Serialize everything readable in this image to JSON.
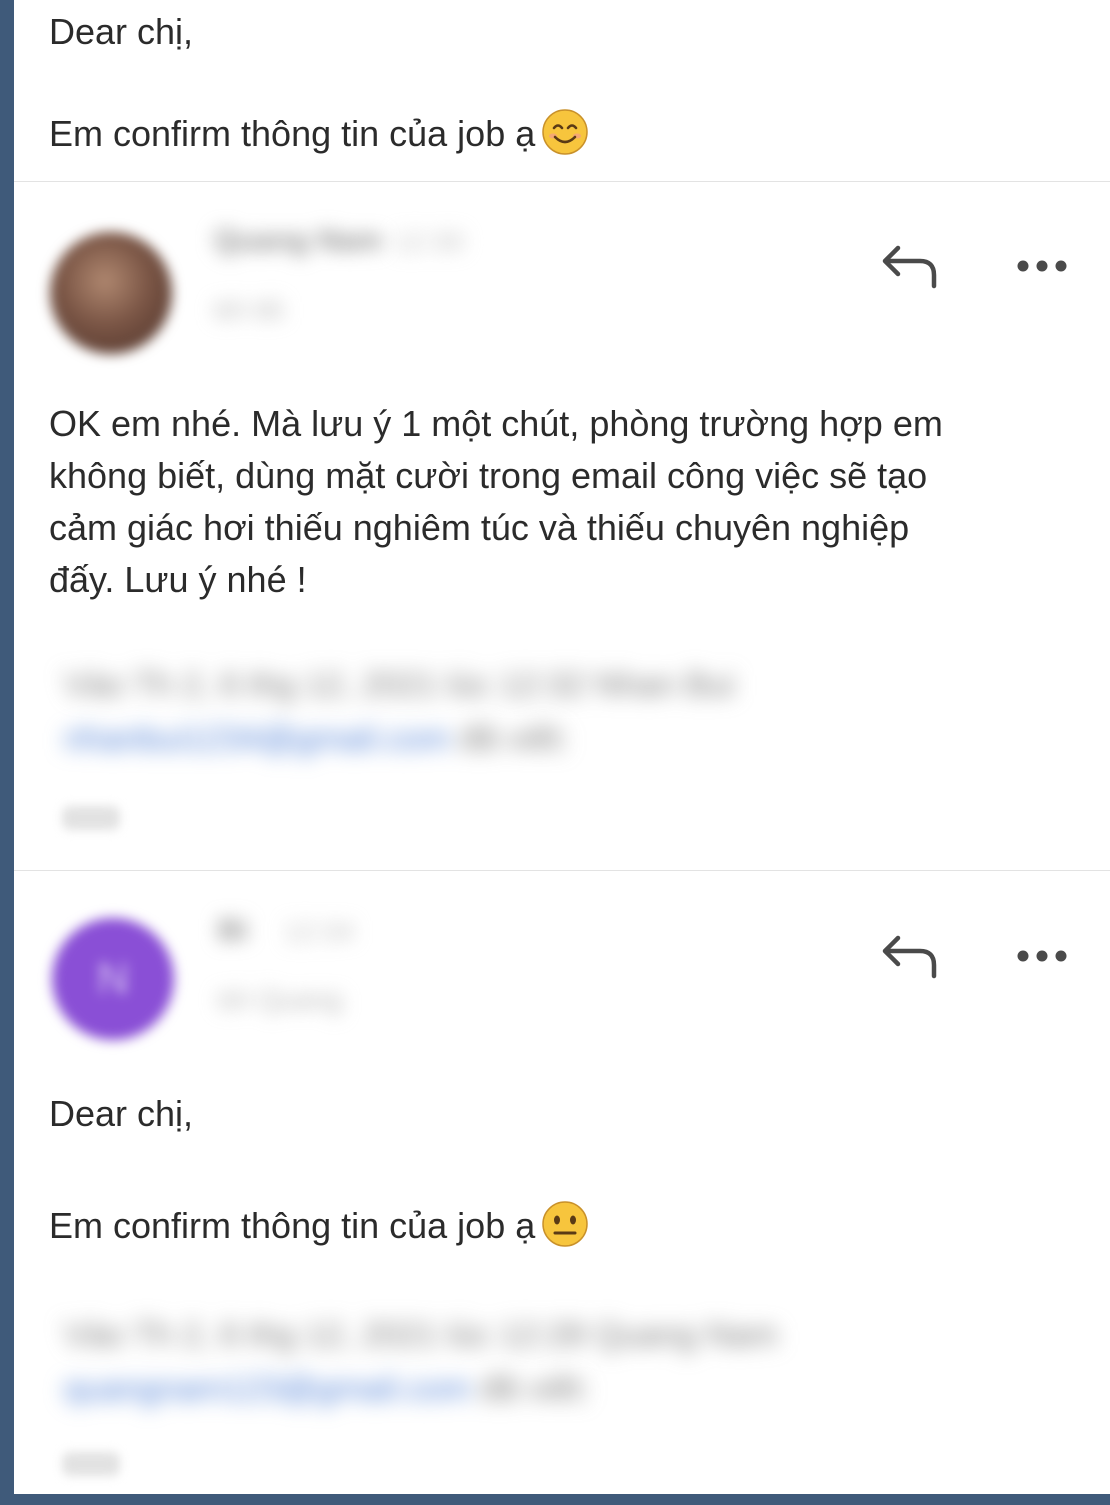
{
  "top_message": {
    "greeting": "Dear chị,",
    "line": "Em confirm thông tin của job ạ",
    "emoji": "smiling-face-emoji"
  },
  "reply_message": {
    "sender_name": "Quang Nam",
    "time": "12:30",
    "to_label": "tới tôi",
    "body": "OK em nhé. Mà lưu ý 1 một chút, phòng trường hợp em\nkhông biết, dùng mặt cười trong email công việc sẽ tạo\ncảm giác hơi thiếu nghiêm túc và thiếu chuyên nghiệp\nđấy. Lưu ý nhé !",
    "quote_header": "Vào Th 2, 6 thg 12, 2021 lúc 12:32 Nhan Bui",
    "quote_email": "nhanbui1234@gmail.com",
    "quote_suffix": "đã viết:",
    "quote_more": "..."
  },
  "original_message": {
    "avatar_letter": "N",
    "sender_name": "Bi",
    "time": "12:34",
    "to_label": "tới Quang",
    "greeting": "Dear chị,",
    "line": "Em confirm thông tin của job ạ",
    "emoji": "neutral-face-emoji",
    "quote_header": "Vào Th 2, 6 thg 12, 2021 lúc 12:28 Quang Nam",
    "quote_email": "quangnam123@gmail.com",
    "quote_suffix": "đã viết:",
    "quote_more": "..."
  },
  "icons": {
    "reply": "reply-arrow-icon",
    "more": "more-horizontal-icon"
  },
  "colors": {
    "background_frame": "#3f5a7a",
    "avatar_purple": "#8a4fd6",
    "link_blue": "#4d7fd6"
  }
}
